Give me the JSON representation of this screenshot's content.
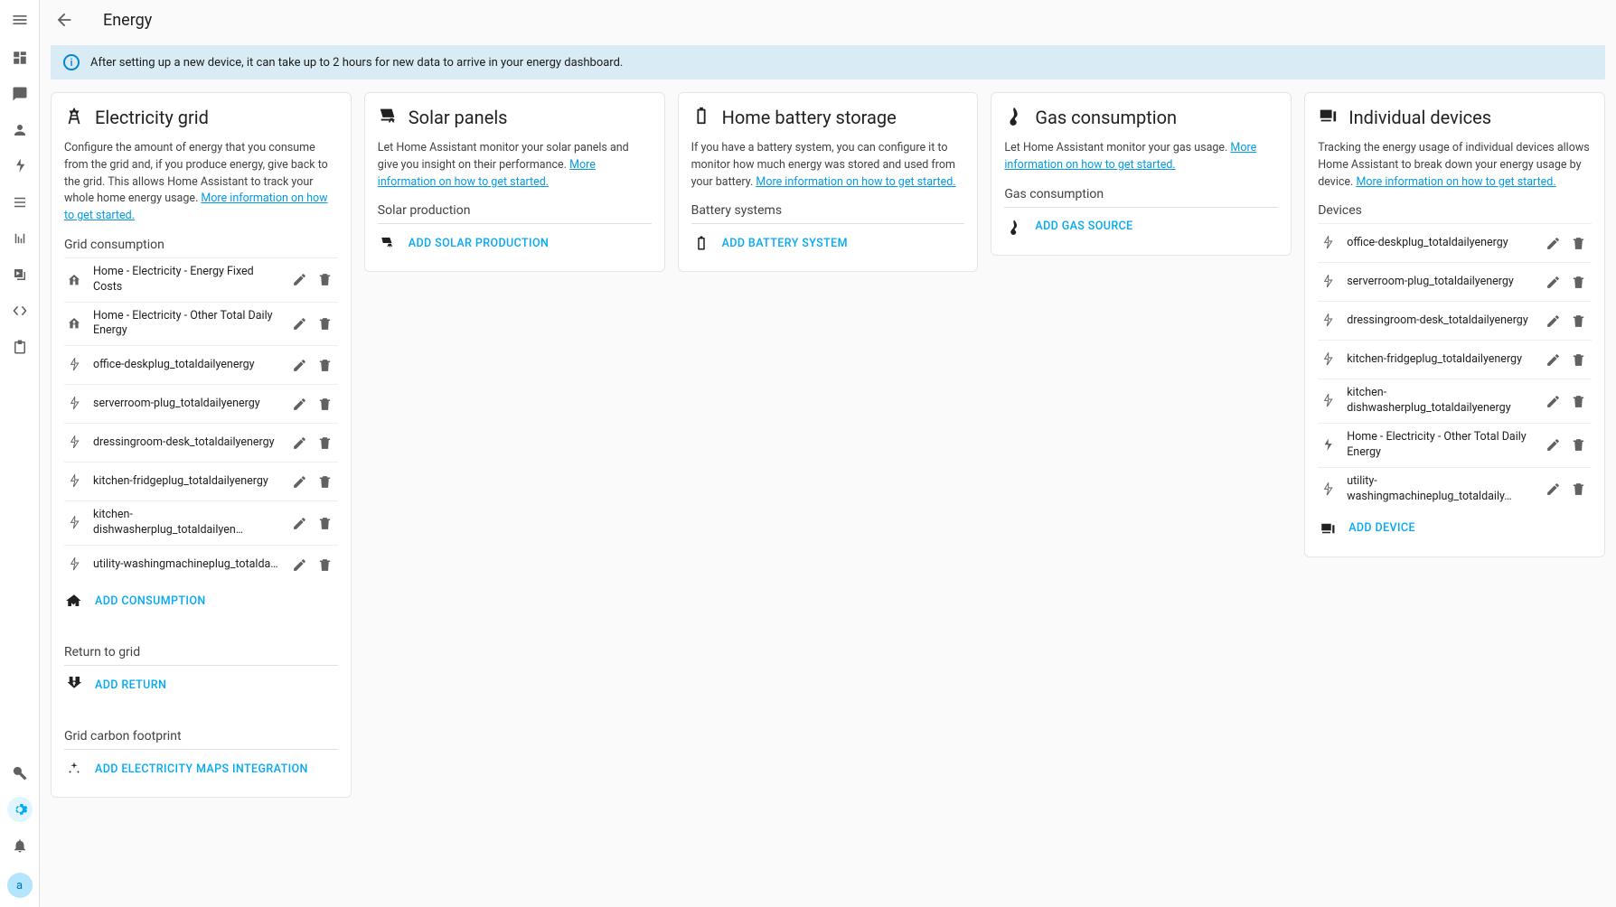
{
  "header": {
    "title": "Energy",
    "hamburger": "≡"
  },
  "banner": {
    "text": "After setting up a new device, it can take up to 2 hours for new data to arrive in your energy dashboard."
  },
  "avatar": "a",
  "cards": {
    "grid": {
      "title": "Electricity grid",
      "desc": "Configure the amount of energy that you consume from the grid and, if you produce energy, give back to the grid. This allows Home Assistant to track your whole home energy usage. ",
      "link": "More information on how to get started.",
      "s1_title": "Grid consumption",
      "s2_title": "Return to grid",
      "s3_title": "Grid carbon footprint",
      "add_consumption": "ADD CONSUMPTION",
      "add_return": "ADD RETURN",
      "add_maps": "ADD ELECTRICITY MAPS INTEGRATION",
      "consumption": [
        {
          "icon": "home-in",
          "label": "Home - Electricity - Energy Fixed Costs"
        },
        {
          "icon": "home-in",
          "label": "Home - Electricity - Other Total Daily Energy"
        },
        {
          "icon": "flash-out",
          "label": "office-deskplug_totaldailyenergy"
        },
        {
          "icon": "flash-out",
          "label": "serverroom-plug_totaldailyenergy"
        },
        {
          "icon": "flash-out",
          "label": "dressingroom-desk_totaldailyenergy"
        },
        {
          "icon": "flash-out",
          "label": "kitchen-fridgeplug_totaldailyenergy"
        },
        {
          "icon": "flash-out",
          "label": "kitchen-dishwasherplug_totaldailyen…"
        },
        {
          "icon": "flash-out",
          "label": "utility-washingmachineplug_totalda…"
        }
      ]
    },
    "solar": {
      "title": "Solar panels",
      "desc": "Let Home Assistant monitor your solar panels and give you insight on their performance. ",
      "link": "More information on how to get started.",
      "s1_title": "Solar production",
      "add_solar": "ADD SOLAR PRODUCTION"
    },
    "battery": {
      "title": "Home battery storage",
      "desc": "If you have a battery system, you can configure it to monitor how much energy was stored and used from your battery. ",
      "link": "More information on how to get started.",
      "s1_title": "Battery systems",
      "add_battery": "ADD BATTERY SYSTEM"
    },
    "gas": {
      "title": "Gas consumption",
      "desc": "Let Home Assistant monitor your gas usage. ",
      "link": "More information on how to get started.",
      "s1_title": "Gas consumption",
      "add_gas": "ADD GAS SOURCE"
    },
    "devices": {
      "title": "Individual devices",
      "desc": "Tracking the energy usage of individual devices allows Home Assistant to break down your energy usage by device. ",
      "link": "More information on how to get started.",
      "s1_title": "Devices",
      "add_device": "ADD DEVICE",
      "items": [
        {
          "icon": "flash-out",
          "label": "office-deskplug_totaldailyenergy"
        },
        {
          "icon": "flash-out",
          "label": "serverroom-plug_totaldailyenergy"
        },
        {
          "icon": "flash-out",
          "label": "dressingroom-desk_totaldailyenergy"
        },
        {
          "icon": "flash-out",
          "label": "kitchen-fridgeplug_totaldailyenergy"
        },
        {
          "icon": "flash-out",
          "label": "kitchen-dishwasherplug_totaldailyenergy"
        },
        {
          "icon": "flash",
          "label": "Home - Electricity - Other Total Daily Energy"
        },
        {
          "icon": "flash-out",
          "label": "utility-washingmachineplug_totaldaily…"
        }
      ]
    }
  }
}
